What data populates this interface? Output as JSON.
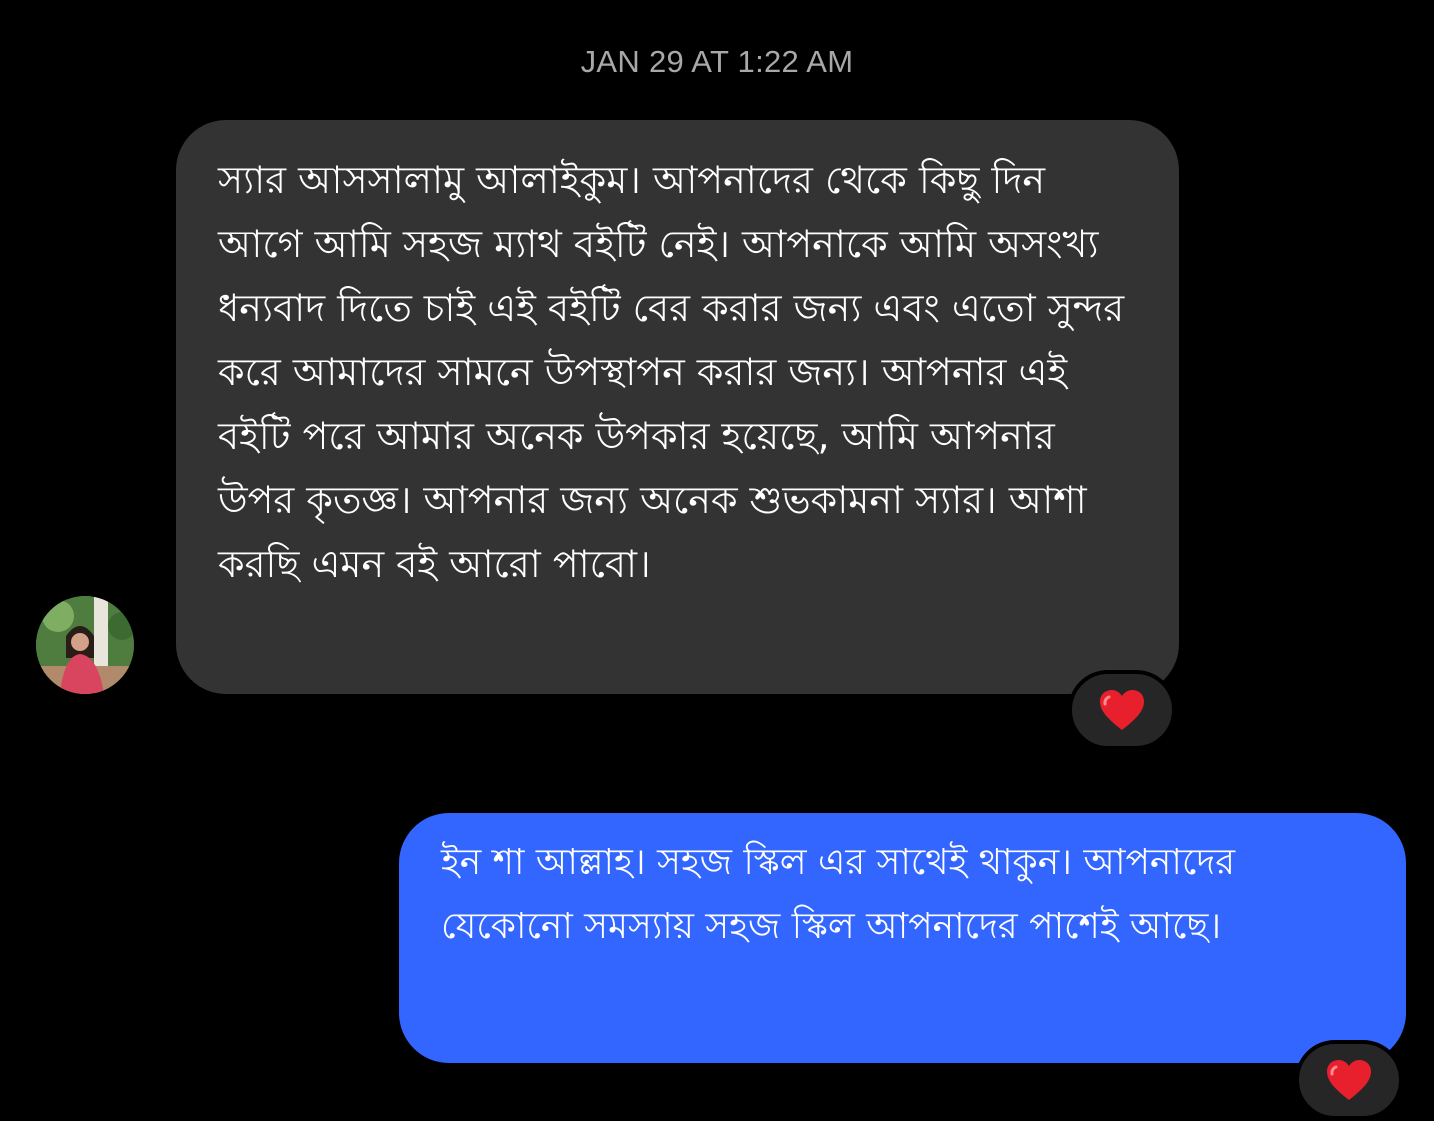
{
  "conversation": {
    "timestamp": "JAN 29 AT 1:22 AM",
    "messages": [
      {
        "direction": "incoming",
        "text": "স্যার আসসালামু আলাইকুম। আপনাদের থেকে কিছু দিন আগে আমি সহজ ম্যাথ বইটি নেই। আপনাকে আমি অসংখ্য ধন্যবাদ দিতে চাই এই বইটি বের করার জন্য এবং এতো সুন্দর করে আমাদের সামনে উপস্থাপন করার জন্য। আপনার এই বইটি পরে আমার অনেক উপকার হয়েছে, আমি আপনার উপর কৃতজ্ঞ। আপনার জন্য অনেক শুভকামনা স্যার। আশা করছি এমন বই আরো পাবো।",
        "reaction": "heart-emoji"
      },
      {
        "direction": "outgoing",
        "text": "ইন শা আল্লাহ। সহজ স্কিল এর সাথেই থাকুন। আপনাদের যেকোনো সমস্যায় সহজ স্কিল আপনাদের পাশেই আছে।",
        "reaction": "heart-emoji"
      }
    ]
  },
  "colors": {
    "background": "#000000",
    "incoming_bubble": "#333333",
    "outgoing_bubble": "#3366ff",
    "timestamp_text": "#a8a8a8",
    "reaction_pill": "#262626",
    "heart": "#e8202e"
  },
  "icons": {
    "avatar": "user-profile-photo",
    "reaction": "heart-emoji"
  }
}
